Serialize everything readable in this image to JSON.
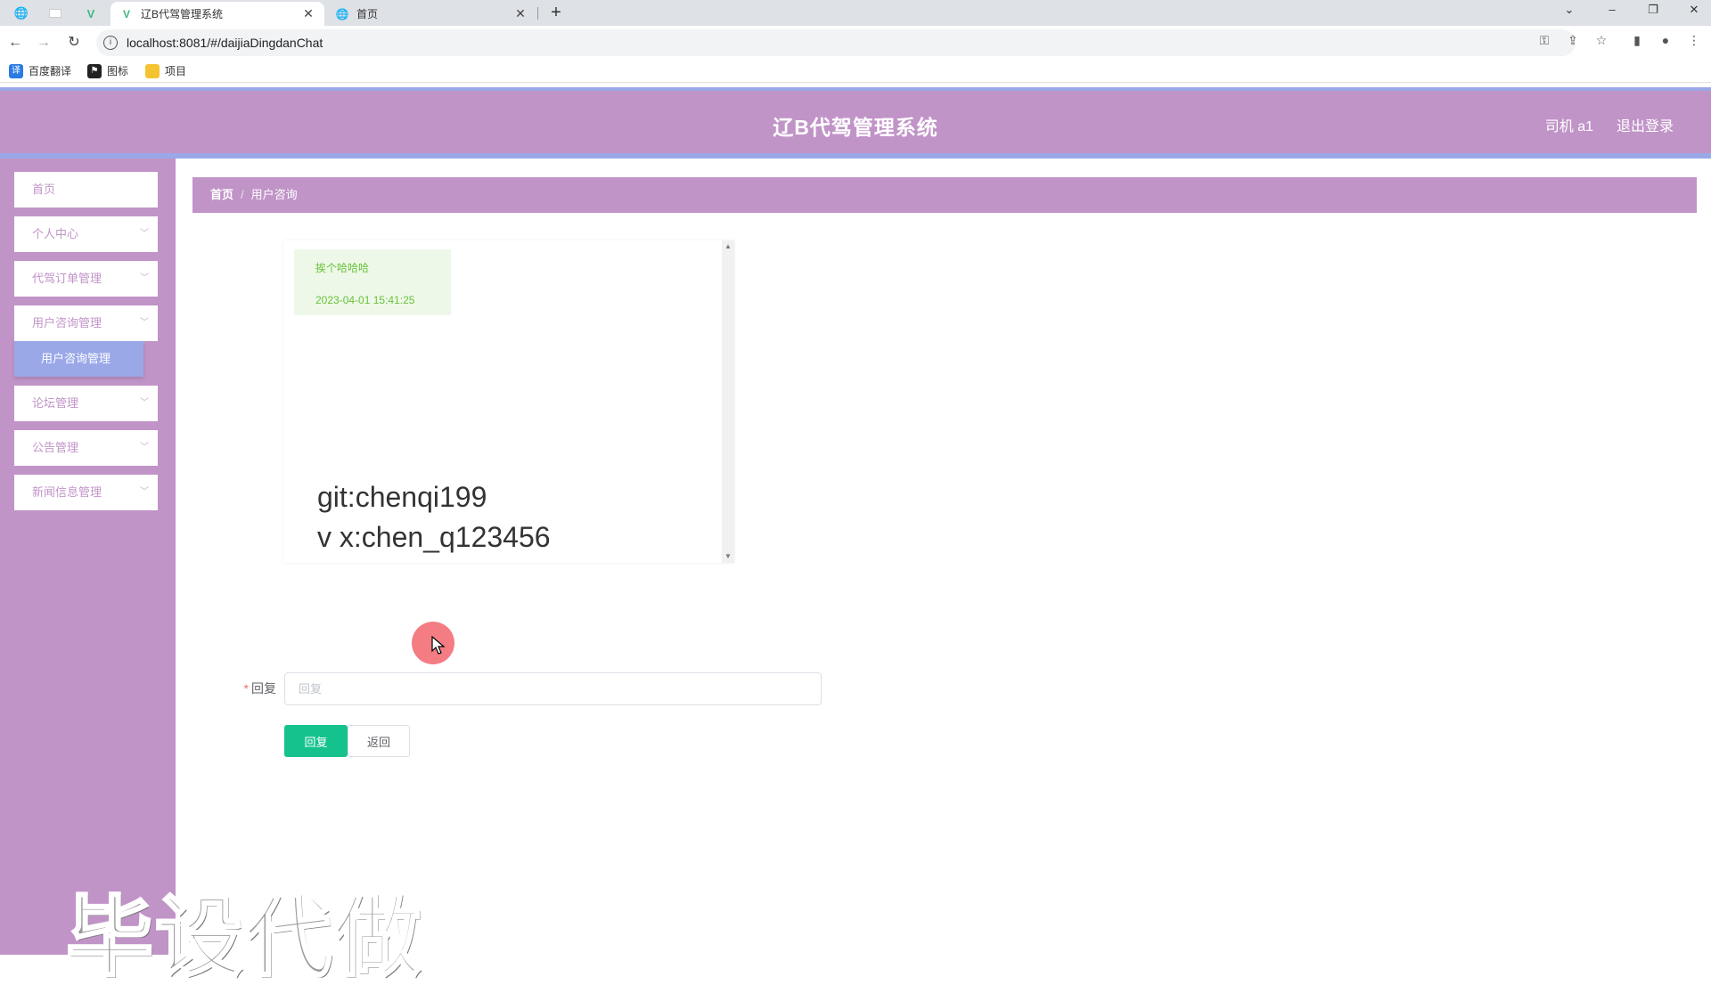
{
  "browser": {
    "tabs": [
      {
        "title": "辽B代驾管理系统",
        "active": true
      },
      {
        "title": "首页",
        "active": false
      }
    ],
    "url": "localhost:8081/#/daijiaDingdanChat",
    "bookmarks": [
      "百度翻译",
      "图标",
      "项目"
    ]
  },
  "header": {
    "title": "辽B代驾管理系统",
    "user": "司机 a1",
    "logout": "退出登录"
  },
  "sidebar": {
    "items": [
      {
        "label": "首页"
      },
      {
        "label": "个人中心"
      },
      {
        "label": "代驾订单管理"
      },
      {
        "label": "用户咨询管理"
      },
      {
        "label": "论坛管理"
      },
      {
        "label": "公告管理"
      },
      {
        "label": "新闻信息管理"
      }
    ],
    "submenu": {
      "label": "用户咨询管理"
    }
  },
  "breadcrumb": {
    "home": "首页",
    "separator": "/",
    "current": "用户咨询"
  },
  "chat": {
    "message": "挨个哈哈哈",
    "timestamp": "2023-04-01 15:41:25"
  },
  "overlay": {
    "line1": "git:chenqi199",
    "line2": "v x:chen_q123456"
  },
  "form": {
    "label": "回复",
    "required_mark": "*",
    "placeholder": "回复",
    "submit": "回复",
    "back": "返回"
  },
  "watermark": "毕设代做",
  "colors": {
    "theme": "#c194c8",
    "accent": "#9aa8e8",
    "success": "#15c28e"
  }
}
